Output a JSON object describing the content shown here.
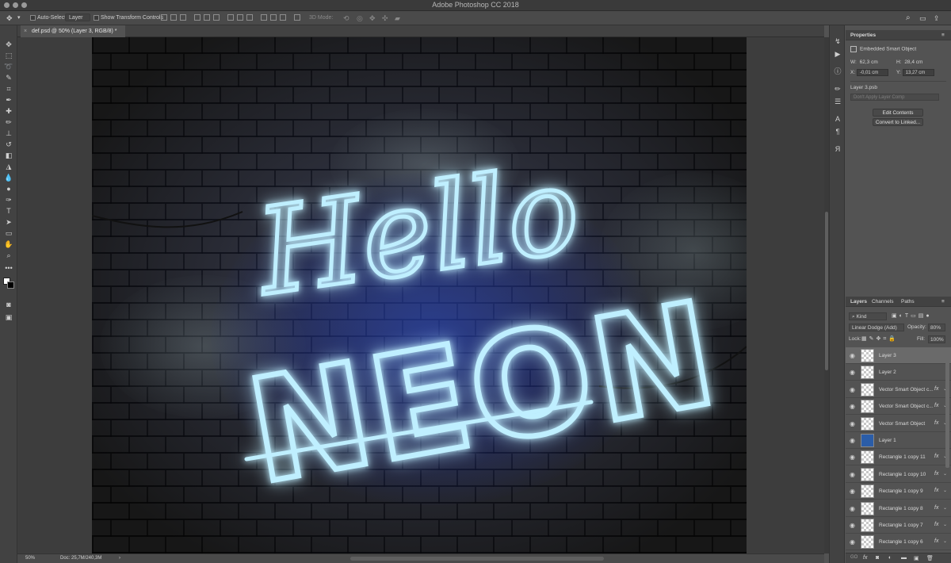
{
  "window": {
    "title": "Adobe Photoshop CC 2018"
  },
  "options_bar": {
    "auto_select_label": "Auto-Select:",
    "auto_select_value": "Layer",
    "transform_label": "Show Transform Controls",
    "mode_3d": "3D Mode:"
  },
  "document": {
    "tab_label": "def.psd @ 50% (Layer 3, RGB/8) *"
  },
  "artwork": {
    "line1": "Hello",
    "line2": "NEON"
  },
  "status": {
    "zoom": "50%",
    "doc": "Doc: 25,7M/240,3M"
  },
  "properties": {
    "tab": "Properties",
    "kind": "Embedded Smart Object",
    "w_label": "W:",
    "w_value": "62,3 cm",
    "h_label": "H:",
    "h_value": "28,4 cm",
    "x_label": "X:",
    "x_value": "-0,01 cm",
    "y_label": "Y:",
    "y_value": "13,27 cm",
    "filename": "Layer 3.psb",
    "comp_placeholder": "Don't Apply Layer Comp",
    "edit_button": "Edit Contents",
    "convert_button": "Convert to Linked..."
  },
  "layers_panel": {
    "tabs": [
      "Layers",
      "Channels",
      "Paths"
    ],
    "filter_kind": "Kind",
    "blend_mode": "Linear Dodge (Add)",
    "opacity_label": "Opacity:",
    "opacity_value": "80%",
    "lock_label": "Lock:",
    "fill_label": "Fill:",
    "fill_value": "100%",
    "layers": [
      {
        "name": "Layer 3",
        "selected": true,
        "fx": false,
        "thumb": "smart"
      },
      {
        "name": "Layer 2",
        "selected": false,
        "fx": false,
        "thumb": "transparent"
      },
      {
        "name": "Vector Smart Object c...",
        "selected": false,
        "fx": true,
        "thumb": "smart"
      },
      {
        "name": "Vector Smart Object c...",
        "selected": false,
        "fx": true,
        "thumb": "smart"
      },
      {
        "name": "Vector Smart Object",
        "selected": false,
        "fx": true,
        "thumb": "smart"
      },
      {
        "name": "Layer 1",
        "selected": false,
        "fx": false,
        "thumb": "blue"
      },
      {
        "name": "Rectangle 1 copy 11",
        "selected": false,
        "fx": true,
        "thumb": "shape"
      },
      {
        "name": "Rectangle 1 copy 10",
        "selected": false,
        "fx": true,
        "thumb": "shape"
      },
      {
        "name": "Rectangle 1 copy 9",
        "selected": false,
        "fx": true,
        "thumb": "shape"
      },
      {
        "name": "Rectangle 1 copy 8",
        "selected": false,
        "fx": true,
        "thumb": "shape"
      },
      {
        "name": "Rectangle 1 copy 7",
        "selected": false,
        "fx": true,
        "thumb": "shape"
      },
      {
        "name": "Rectangle 1 copy 6",
        "selected": false,
        "fx": true,
        "thumb": "shape"
      }
    ],
    "footer_link": "GO",
    "footer_fx": "fx"
  },
  "colors": {
    "neon": "#9fe6ff",
    "neon_glow": "#2a6dff",
    "selection": "#6a6a6a"
  }
}
